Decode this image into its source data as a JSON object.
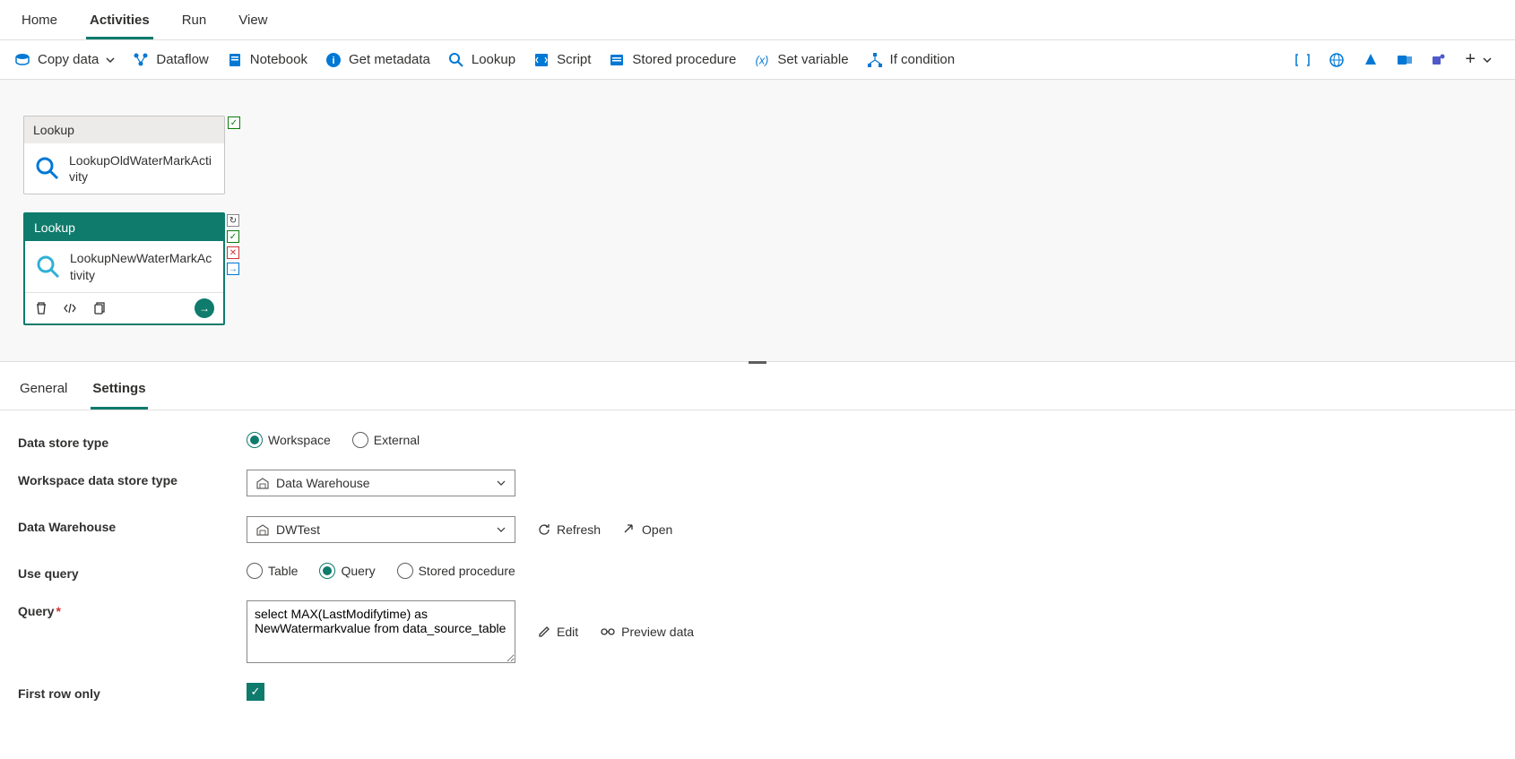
{
  "topNav": [
    "Home",
    "Activities",
    "Run",
    "View"
  ],
  "topNavActive": 1,
  "toolbar": {
    "items": [
      {
        "label": "Copy data",
        "hasDropdown": true,
        "icon": "copy-data"
      },
      {
        "label": "Dataflow",
        "icon": "dataflow"
      },
      {
        "label": "Notebook",
        "icon": "notebook"
      },
      {
        "label": "Get metadata",
        "icon": "metadata"
      },
      {
        "label": "Lookup",
        "icon": "lookup"
      },
      {
        "label": "Script",
        "icon": "script"
      },
      {
        "label": "Stored procedure",
        "icon": "stored-proc"
      },
      {
        "label": "Set variable",
        "icon": "variable"
      },
      {
        "label": "If condition",
        "icon": "if-condition"
      }
    ]
  },
  "activities": [
    {
      "type": "Lookup",
      "name": "LookupOldWaterMarkActivity",
      "selected": false
    },
    {
      "type": "Lookup",
      "name": "LookupNewWaterMarkActivity",
      "selected": true
    }
  ],
  "panelTabs": [
    "General",
    "Settings"
  ],
  "panelTabActive": 1,
  "settings": {
    "labels": {
      "dataStoreType": "Data store type",
      "workspaceDataStoreType": "Workspace data store type",
      "dataWarehouse": "Data Warehouse",
      "useQuery": "Use query",
      "query": "Query",
      "firstRowOnly": "First row only"
    },
    "dataStoreType": {
      "options": [
        "Workspace",
        "External"
      ],
      "selected": "Workspace"
    },
    "workspaceDataStoreType": "Data Warehouse",
    "dataWarehouse": "DWTest",
    "actions": {
      "refresh": "Refresh",
      "open": "Open",
      "edit": "Edit",
      "previewData": "Preview data"
    },
    "useQuery": {
      "options": [
        "Table",
        "Query",
        "Stored procedure"
      ],
      "selected": "Query"
    },
    "query": "select MAX(LastModifytime) as NewWatermarkvalue from data_source_table",
    "firstRowOnly": true
  }
}
